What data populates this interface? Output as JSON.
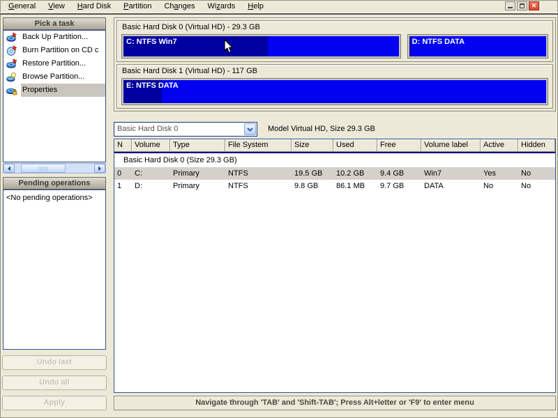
{
  "menu": {
    "items": [
      {
        "pre": "",
        "m": "G",
        "post": "eneral"
      },
      {
        "pre": "",
        "m": "V",
        "post": "iew"
      },
      {
        "pre": "",
        "m": "H",
        "post": "ard Disk"
      },
      {
        "pre": "",
        "m": "P",
        "post": "artition"
      },
      {
        "pre": "Ch",
        "m": "a",
        "post": "nges"
      },
      {
        "pre": "Wi",
        "m": "z",
        "post": "ards"
      },
      {
        "pre": "",
        "m": "H",
        "post": "elp"
      }
    ]
  },
  "window_controls": {
    "close_glyph": "✕"
  },
  "sidebar": {
    "tasks_header": "Pick a task",
    "tasks": [
      {
        "label": "Back Up Partition...",
        "icon": "backup-partition-icon",
        "selected": false
      },
      {
        "label": "Burn Partition on CD c",
        "icon": "burn-cd-icon",
        "selected": false
      },
      {
        "label": "Restore Partition...",
        "icon": "restore-partition-icon",
        "selected": false
      },
      {
        "label": "Browse Partition...",
        "icon": "browse-partition-icon",
        "selected": false
      },
      {
        "label": "Properties",
        "icon": "properties-icon",
        "selected": true
      }
    ],
    "pending_header": "Pending operations",
    "pending_empty": "<No pending operations>",
    "buttons": {
      "undo_last": "Undo last",
      "undo_all": "Undo all",
      "apply": "Apply"
    }
  },
  "disks": [
    {
      "title": "Basic Hard Disk 0 (Virtual HD) - 29.3 GB",
      "partitions": [
        {
          "label": "C: NTFS Win7",
          "size_gb": 19.5,
          "used_pct": 52
        },
        {
          "label": "D: NTFS DATA",
          "size_gb": 9.8,
          "used_pct": 1
        }
      ]
    },
    {
      "title": "Basic Hard Disk 1 (Virtual HD) - 117 GB",
      "partitions": [
        {
          "label": "E: NTFS DATA",
          "size_gb": 117,
          "used_pct": 9
        }
      ]
    }
  ],
  "disk_selector": {
    "value": "Basic Hard Disk 0",
    "info": "Model Virtual HD, Size 29.3 GB"
  },
  "table": {
    "columns": [
      "N",
      "Volume",
      "Type",
      "File System",
      "Size",
      "Used",
      "Free",
      "Volume label",
      "Active",
      "Hidden"
    ],
    "group_row": "Basic Hard Disk 0 (Size 29.3 GB)",
    "rows": [
      {
        "cells": [
          "0",
          "C:",
          "Primary",
          "NTFS",
          "19.5 GB",
          "10.2 GB",
          "9.4 GB",
          "Win7",
          "Yes",
          "No"
        ],
        "selected": true
      },
      {
        "cells": [
          "1",
          "D:",
          "Primary",
          "NTFS",
          "9.8 GB",
          "86.1 MB",
          "9.7 GB",
          "DATA",
          "No",
          "No"
        ],
        "selected": false
      }
    ]
  },
  "status_bar": {
    "text": "Navigate through 'TAB' and 'Shift-TAB'; Press Alt+letter or 'F9' to enter menu"
  },
  "colors": {
    "background": "#ECE9D8",
    "partition_free": "#0202F0",
    "partition_used": "#0000A0",
    "panel_border": "#2F4E8E",
    "selected_row": "#D3D1C9",
    "selected_task": "#C9C6BE",
    "close_button": "#D8472F"
  }
}
